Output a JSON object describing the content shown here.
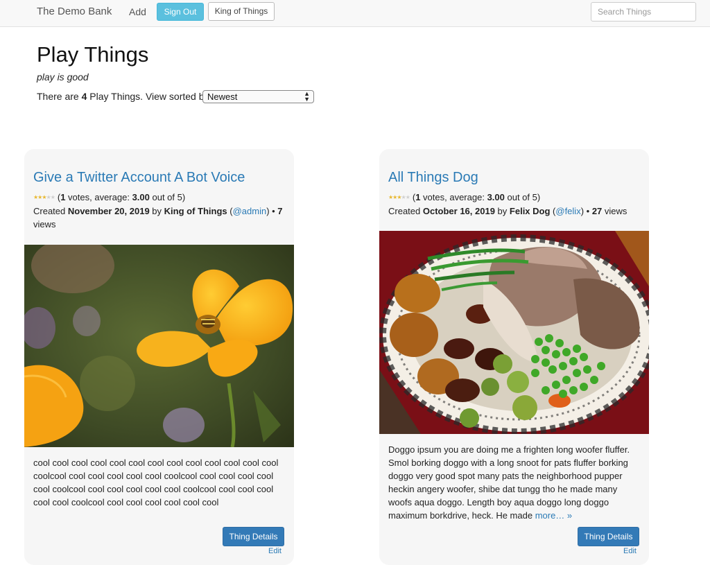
{
  "navbar": {
    "brand": "The Demo Bank",
    "add_label": "Add",
    "signout_label": "Sign Out",
    "user_label": "King of Things",
    "search_placeholder": "Search Things"
  },
  "header": {
    "title": "Play Things",
    "subtitle": "play is good",
    "count_prefix": "There are ",
    "count": "4",
    "count_suffix": " Play Things. View sorted by",
    "sort_selected": "Newest"
  },
  "cards": [
    {
      "title": "Give a Twitter Account A Bot Voice",
      "rating": 3.0,
      "votes": "1",
      "votes_text": " votes, average: ",
      "average": "3.00",
      "out_of": " out of 5)",
      "created_prefix": "Created ",
      "created_date": "November 20, 2019",
      "by_text": " by ",
      "author": "King of Things",
      "handle": "@admin",
      "views_sep": ") • ",
      "views": "7",
      "views_label": " views",
      "description": "cool cool cool cool cool cool cool   cool cool cool cool cool cool coolcool cool cool cool cool cool coolcool cool cool cool cool cool coolcool cool cool cool cool cool coolcool cool cool cool cool cool coolcool cool cool cool cool cool cool",
      "more_label": "",
      "details_label": "Thing Details",
      "edit_label": "Edit"
    },
    {
      "title": "All Things Dog",
      "rating": 3.0,
      "votes": "1",
      "votes_text": " votes, average: ",
      "average": "3.00",
      "out_of": " out of 5)",
      "created_prefix": "Created ",
      "created_date": "October 16, 2019",
      "by_text": " by ",
      "author": "Felix Dog",
      "handle": "@felix",
      "views_sep": ") • ",
      "views": "27",
      "views_label": " views",
      "description": "Doggo ipsum you are doing me a frighten long woofer fluffer. Smol borking doggo with a long snoot for pats fluffer borking doggo very good spot many pats the neighborhood pupper heckin angery woofer, shibe dat tungg tho he made many woofs aqua doggo. Length boy aqua doggo long doggo maximum borkdrive, heck. He made ",
      "more_label": "more… »",
      "details_label": "Thing Details",
      "edit_label": "Edit"
    }
  ]
}
